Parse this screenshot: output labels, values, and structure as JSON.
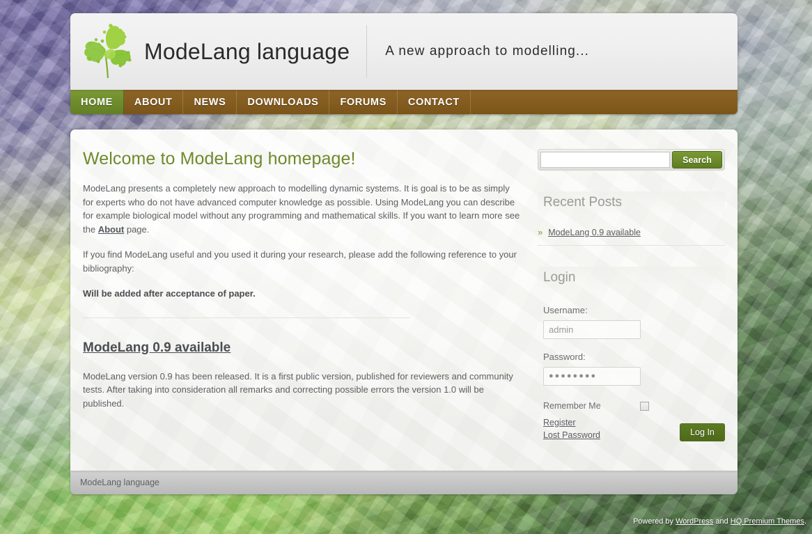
{
  "site": {
    "title": "ModeLang language",
    "tagline": "A new approach to modelling...",
    "logo_icon": "leaf-icon"
  },
  "nav": {
    "items": [
      {
        "label": "HOME",
        "active": true
      },
      {
        "label": "ABOUT",
        "active": false
      },
      {
        "label": "NEWS",
        "active": false
      },
      {
        "label": "DOWNLOADS",
        "active": false
      },
      {
        "label": "FORUMS",
        "active": false
      },
      {
        "label": "CONTACT",
        "active": false
      }
    ]
  },
  "main": {
    "heading": "Welcome to ModeLang homepage!",
    "intro_part1": "ModeLang presents a completely new approach to modelling dynamic systems. It is goal is to be as simply for experts who do not have advanced computer knowledge as possible. Using ModeLang you can describe for example biological model without any programming and mathematical skills. If you want to learn more see the ",
    "intro_link": "About",
    "intro_part2": " page.",
    "reference_para": "If you find ModeLang useful and you used it during your research, please add the following reference to your bibliography:",
    "reference_note": "Will be added after acceptance of paper.",
    "post": {
      "title": "ModeLang 0.9 available",
      "body": "ModeLang version 0.9 has been released. It is a first public version, published for reviewers and community tests. After taking into consideration all remarks and correcting possible errors the version 1.0 will be published."
    }
  },
  "sidebar": {
    "search": {
      "value": "",
      "placeholder": "",
      "button_label": "Search",
      "icon": "search-icon"
    },
    "recent_posts": {
      "title": "Recent Posts",
      "bullet": "»",
      "items": [
        {
          "label": "ModeLang 0.9 available"
        }
      ]
    },
    "login": {
      "title": "Login",
      "username_label": "Username:",
      "username_value": "admin",
      "password_label": "Password:",
      "password_value": "●●●●●●●●",
      "remember_label": "Remember Me",
      "remember_checked": false,
      "register_label": "Register",
      "lost_password_label": "Lost Password",
      "submit_label": "Log In"
    }
  },
  "footer": {
    "text": "ModeLang language",
    "credit_prefix": "Powered by ",
    "credit_link1": "WordPress",
    "credit_middle": " and ",
    "credit_link2": "HQ Premium Themes",
    "credit_suffix": "."
  },
  "colors": {
    "nav_brown": "#845c20",
    "nav_active_green": "#6d8a2b",
    "heading_green": "#6f8a2c",
    "button_green": "#5f7d22",
    "body_text": "#5d6063"
  }
}
